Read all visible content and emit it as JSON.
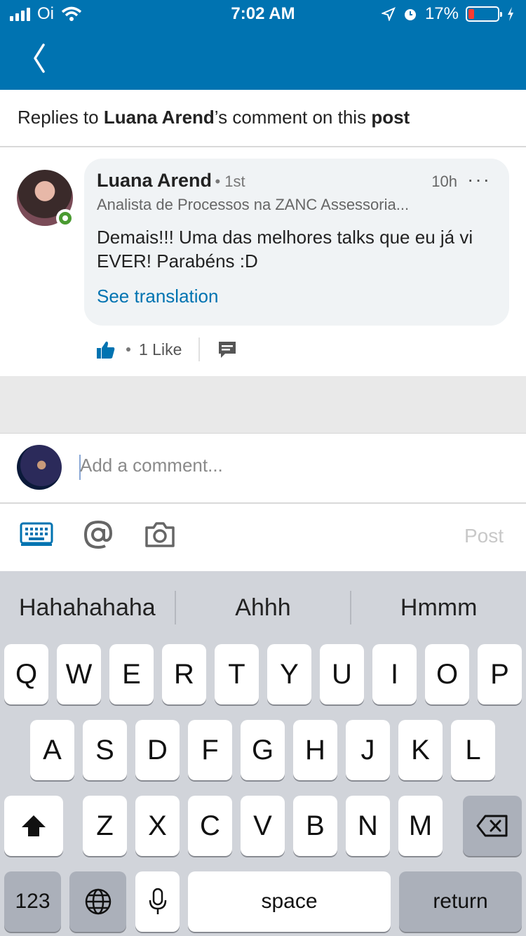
{
  "status_bar": {
    "carrier": "Oi",
    "time": "7:02 AM",
    "battery": "17%",
    "battery_level": 0.17
  },
  "colors": {
    "brand": "#0073b1",
    "online": "#4a9a31",
    "battery_low": "#ff3b30"
  },
  "nav": {
    "back_icon": "chevron-left-icon"
  },
  "header": {
    "prefix": "Replies to ",
    "author": "Luana Arend",
    "middle": "’s comment on this ",
    "post_word": "post"
  },
  "comment": {
    "author": "Luana Arend",
    "degree": "• 1st",
    "time": "10h",
    "more": "···",
    "headline": "Analista de Processos na ZANC Assessoria...",
    "text": "Demais!!! Uma das melhores talks que eu já vi EVER! Parabéns :D",
    "translate": "See translation",
    "likes": "1 Like"
  },
  "composer": {
    "placeholder": "Add a comment...",
    "post_label": "Post",
    "icons": [
      "keyboard-icon",
      "mention-icon",
      "camera-icon"
    ]
  },
  "keyboard": {
    "suggestions": [
      "Hahahahaha",
      "Ahhh",
      "Hmmm"
    ],
    "row1": [
      "Q",
      "W",
      "E",
      "R",
      "T",
      "Y",
      "U",
      "I",
      "O",
      "P"
    ],
    "row2": [
      "A",
      "S",
      "D",
      "F",
      "G",
      "H",
      "J",
      "K",
      "L"
    ],
    "row3": [
      "Z",
      "X",
      "C",
      "V",
      "B",
      "N",
      "M"
    ],
    "numbers": "123",
    "space": "space",
    "return": "return"
  }
}
